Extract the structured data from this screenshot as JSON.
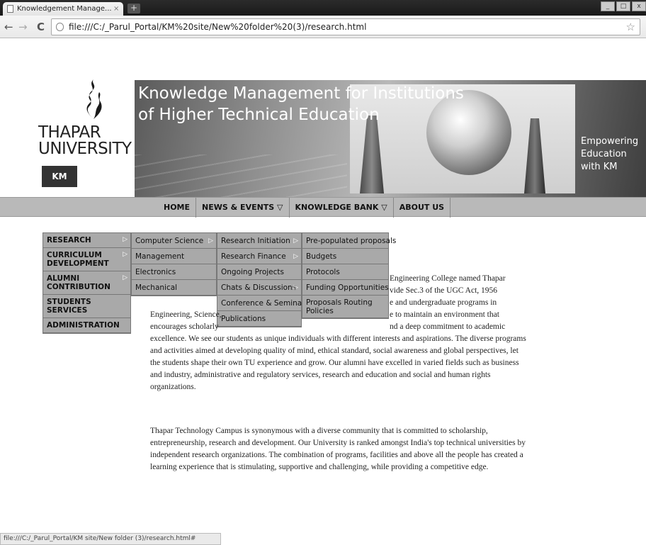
{
  "browser": {
    "tab_title": "Knowledgement Manage...",
    "tab_close": "×",
    "new_tab": "+",
    "url": "file:///C:/_Parul_Portal/KM%20site/New%20folder%20(3)/research.html",
    "back": "←",
    "forward": "→",
    "reload": "C",
    "bookmark": "☆",
    "status_url": "file:///C:/_Parul_Portal/KM site/New folder (3)/research.html#"
  },
  "header": {
    "logo_line1": "THAPAR",
    "logo_line2": "UNIVERSITY",
    "km_badge": "KM",
    "banner_line1": "Knowledge Management for Institutions",
    "banner_line2": "of Higher Technical Education",
    "tagline_1": "Empowering",
    "tagline_2": "Education",
    "tagline_3": "with KM"
  },
  "main_nav": [
    {
      "label": "HOME"
    },
    {
      "label": "NEWS & EVENTS ▽"
    },
    {
      "label": "KNOWLEDGE BANK ▽"
    },
    {
      "label": "ABOUT US"
    }
  ],
  "sidebar": [
    {
      "label": "RESEARCH",
      "has_sub": true
    },
    {
      "label": "CURRICULUM DEVELOPMENT",
      "has_sub": true
    },
    {
      "label": "ALUMNI CONTRIBUTION",
      "has_sub": true
    },
    {
      "label": "STUDENTS SERVICES",
      "has_sub": false
    },
    {
      "label": "ADMINISTRATION",
      "has_sub": false
    }
  ],
  "flyout_1": [
    {
      "label": "Computer Science",
      "has_sub": true
    },
    {
      "label": "Management",
      "has_sub": false
    },
    {
      "label": "Electronics",
      "has_sub": false
    },
    {
      "label": "Mechanical",
      "has_sub": false
    }
  ],
  "flyout_2": [
    {
      "label": "Research Initiation",
      "has_sub": true
    },
    {
      "label": "Research Finance",
      "has_sub": true
    },
    {
      "label": "Ongoing Projects",
      "has_sub": false
    },
    {
      "label": "Chats & Discussions",
      "has_sub": true
    },
    {
      "label": "Conference & Seminar",
      "has_sub": false
    },
    {
      "label": "Publications",
      "has_sub": false
    }
  ],
  "flyout_3": [
    {
      "label": "Pre-populated proposals"
    },
    {
      "label": "Budgets"
    },
    {
      "label": "Protocols"
    },
    {
      "label": "Funding Opportunities"
    },
    {
      "label": "Proposals Routing Policies"
    }
  ],
  "content": {
    "p1_lines": [
      "Engineering College named Thapar",
      "vide Sec.3 of the UGC Act, 1956",
      "e and undergraduate programs in",
      "Engineering, Science,",
      "e to maintain an environment that",
      "encourages scholarly",
      "nd a deep commitment to academic",
      "excellence. We see our students as unique individuals with different interests and aspirations. The diverse programs",
      "and activities aimed at developing quality of mind, ethical standard, social awareness and global perspectives, let",
      "the students shape their own TU experience and grow. Our alumni have excelled in varied fields such as business",
      "and industry, administrative and regulatory services, research and education and social and human rights",
      "organizations."
    ],
    "p2_lines": [
      "Thapar Technology Campus is synonymous with a diverse community that is committed to scholarship,",
      "entrepreneurship, research and development. Our University is ranked amongst India's top technical universities by",
      "independent research organizations. The combination of programs, facilities and above all the people has created a",
      "learning experience that is stimulating, supportive and challenging, while providing a competitive edge."
    ]
  }
}
